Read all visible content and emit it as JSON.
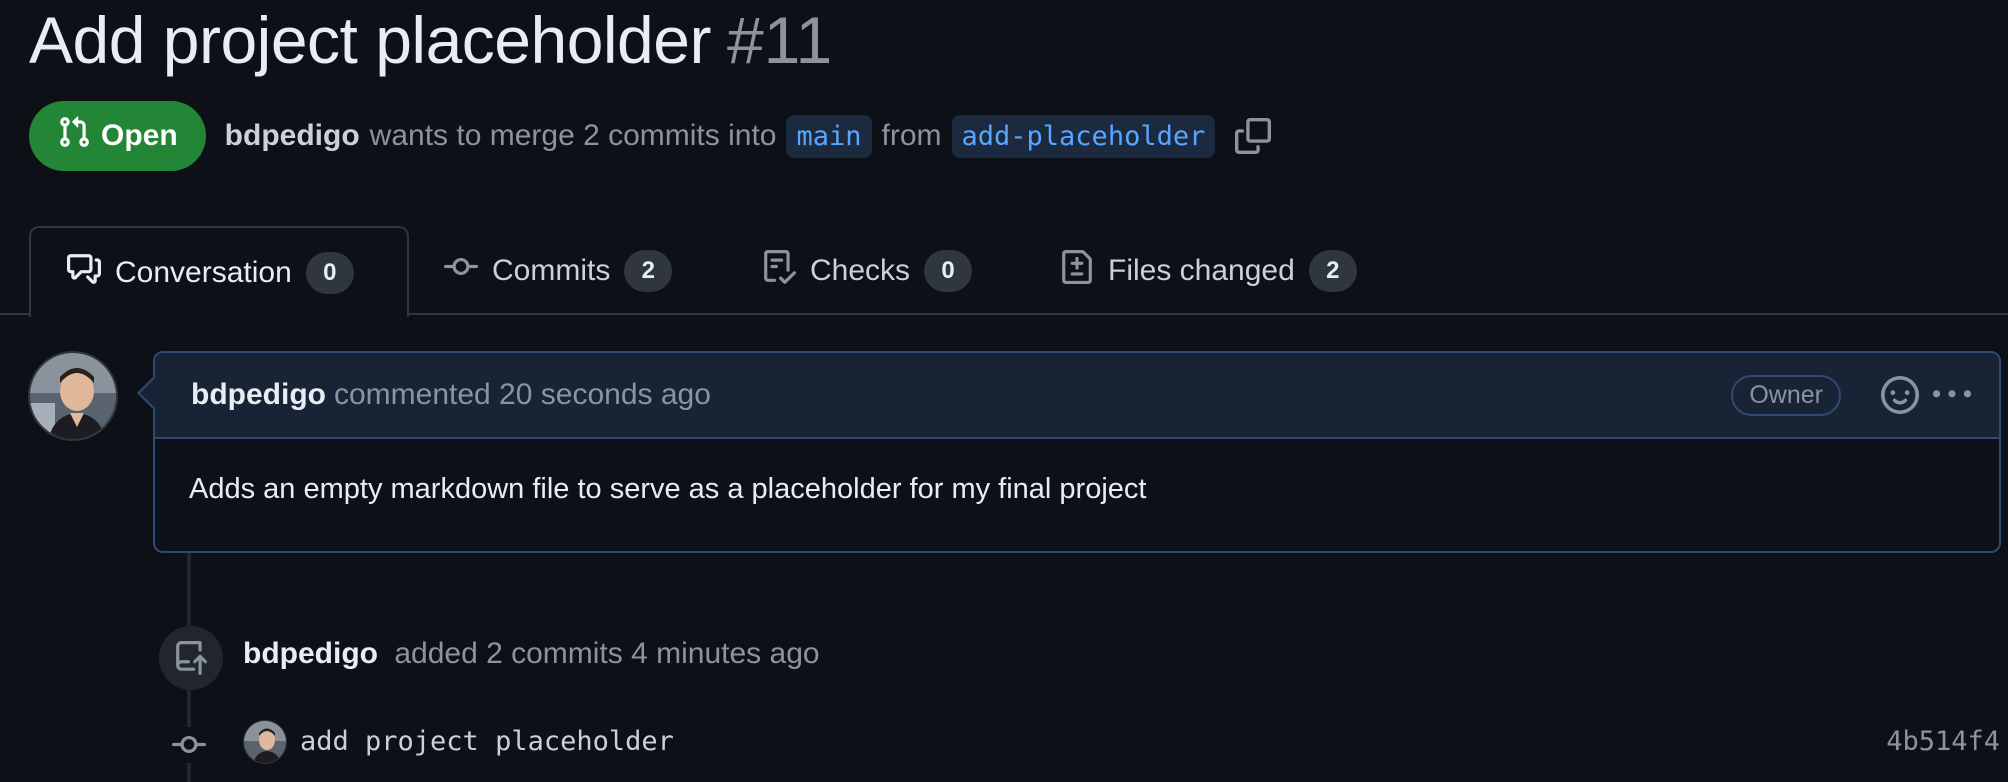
{
  "pr": {
    "title": "Add project placeholder",
    "number": "#11",
    "state": "Open",
    "author": "bdpedigo",
    "merge_text_1": "wants to merge 2 commits into",
    "base_branch": "main",
    "merge_text_2": "from",
    "head_branch": "add-placeholder"
  },
  "tabs": [
    {
      "label": "Conversation",
      "count": "0",
      "icon": "comment-discussion-icon",
      "selected": true
    },
    {
      "label": "Commits",
      "count": "2",
      "icon": "git-commit-icon",
      "selected": false
    },
    {
      "label": "Checks",
      "count": "0",
      "icon": "checklist-icon",
      "selected": false
    },
    {
      "label": "Files changed",
      "count": "2",
      "icon": "file-diff-icon",
      "selected": false
    }
  ],
  "comment": {
    "author": "bdpedigo",
    "action": "commented 20 seconds ago",
    "role_badge": "Owner",
    "body": "Adds an empty markdown file to serve as a placeholder for my final project"
  },
  "timeline_event": {
    "author": "bdpedigo",
    "text": "added 2 commits 4 minutes ago",
    "icon": "repo-push-icon"
  },
  "commit": {
    "message": "add project placeholder",
    "sha": "4b514f4"
  },
  "colors": {
    "background": "#0d1117",
    "open_badge": "#238636",
    "branch_text": "#58a6ff",
    "comment_header": "#182436",
    "comment_border": "#2f4a74"
  }
}
